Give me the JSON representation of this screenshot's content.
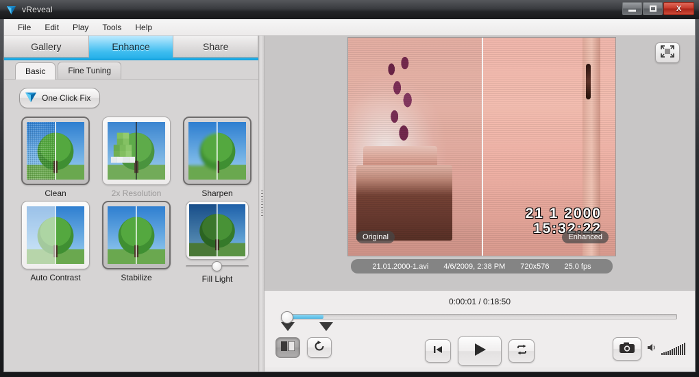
{
  "window": {
    "title": "vReveal",
    "app_icon": "vreveal-diamond-icon",
    "buttons": {
      "minimize": "minimize-icon",
      "maximize": "maximize-icon",
      "close": "X"
    }
  },
  "menubar": {
    "items": [
      "File",
      "Edit",
      "Play",
      "Tools",
      "Help"
    ]
  },
  "main_tabs": [
    {
      "label": "Gallery",
      "active": false
    },
    {
      "label": "Enhance",
      "active": true
    },
    {
      "label": "Share",
      "active": false
    }
  ],
  "sub_tabs": [
    {
      "label": "Basic",
      "active": true
    },
    {
      "label": "Fine Tuning",
      "active": false
    }
  ],
  "one_click_fix": {
    "label": "One Click Fix",
    "icon": "diamond-icon"
  },
  "tools": [
    {
      "label": "Clean",
      "state": "selected",
      "thumb": "tree-noise-comparison"
    },
    {
      "label": "2x Resolution",
      "state": "disabled",
      "thumb": "tree-pixelated-comparison"
    },
    {
      "label": "Sharpen",
      "state": "normal",
      "thumb": "tree-blur-comparison"
    },
    {
      "label": "Auto Contrast",
      "state": "normal",
      "thumb": "tree-contrast-comparison"
    },
    {
      "label": "Stabilize",
      "state": "selected",
      "thumb": "tree-stabilize-comparison"
    },
    {
      "label": "Fill Light",
      "state": "normal",
      "thumb": "tree-fill-light-comparison",
      "slider_value": 50
    }
  ],
  "viewer": {
    "fullscreen_icon": "fullscreen-icon",
    "labels": {
      "original": "Original",
      "enhanced": "Enhanced"
    },
    "video_timestamp": {
      "date": "21  1 2000",
      "time": "15:32:22"
    },
    "info": {
      "filename": "21.01.2000-1.avi",
      "datetime": "4/6/2009, 2:38 PM",
      "resolution": "720x576",
      "framerate": "25.0 fps"
    }
  },
  "transport": {
    "timecode": "0:00:01 / 0:18:50",
    "current_time": "0:00:01",
    "total_time": "0:18:50",
    "seek_percent": 1,
    "controls": {
      "split_view": "split-view-icon",
      "rotate": "rotate-icon",
      "skip_start": "skip-to-start-icon",
      "play": "play-icon",
      "loop": "loop-icon",
      "snapshot": "camera-icon",
      "volume": "volume-icon"
    }
  },
  "colors": {
    "accent": "#29b2ea",
    "seek_fill": "#4fb8e4",
    "close_button": "#c6392b",
    "panel_bg": "#d6d4d4"
  }
}
